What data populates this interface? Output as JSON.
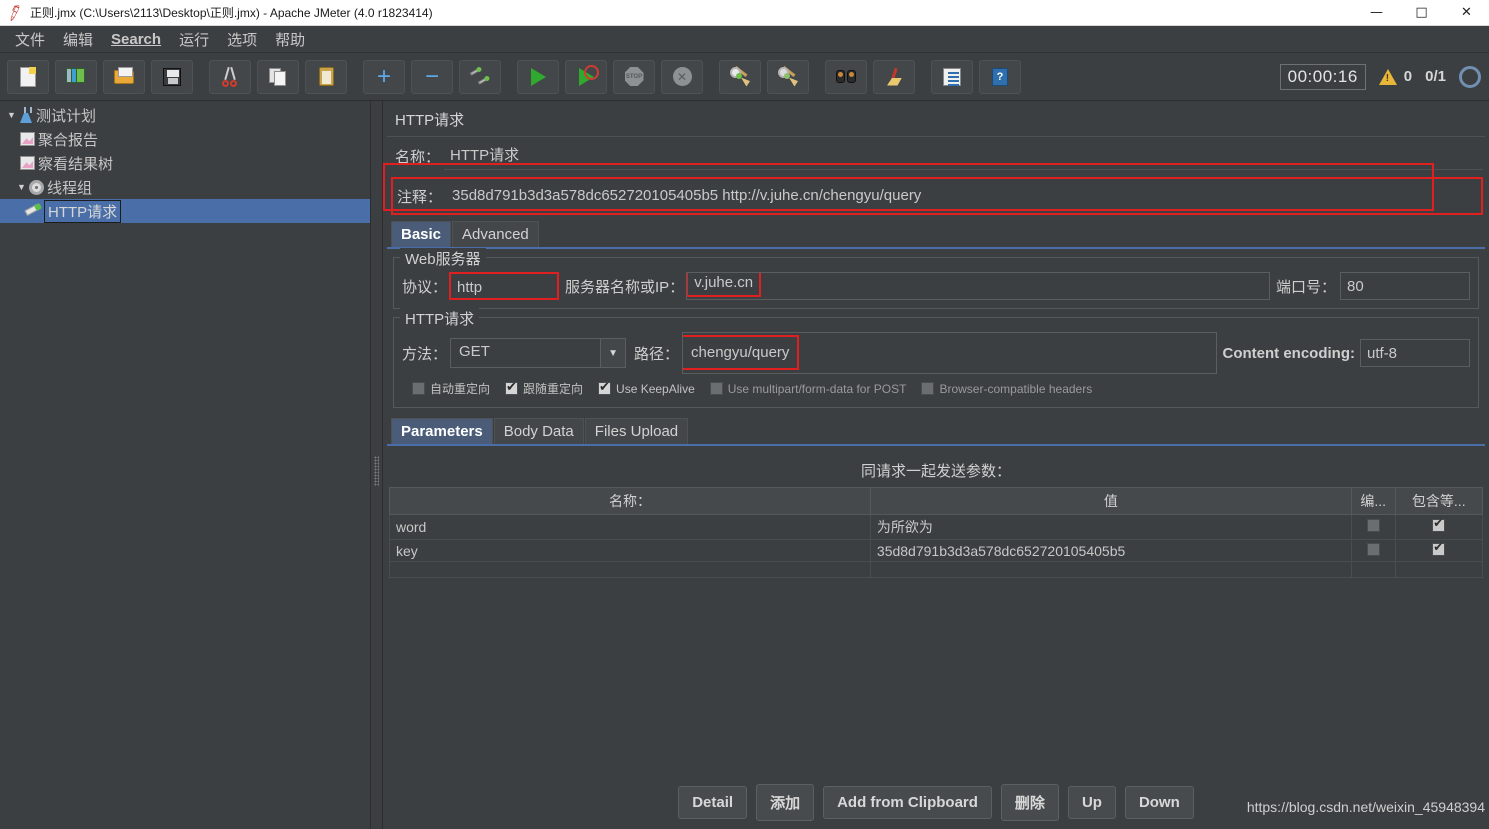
{
  "window": {
    "title": "正则.jmx (C:\\Users\\2113\\Desktop\\正则.jmx) - Apache JMeter (4.0 r1823414)",
    "app_icon": "jmeter-feather-icon",
    "minimize": "—",
    "maximize": "□",
    "close": "✕"
  },
  "menu": [
    {
      "label": "文件",
      "name": "menu-file"
    },
    {
      "label": "编辑",
      "name": "menu-edit"
    },
    {
      "label": "Search",
      "name": "menu-search"
    },
    {
      "label": "运行",
      "name": "menu-run"
    },
    {
      "label": "选项",
      "name": "menu-options"
    },
    {
      "label": "帮助",
      "name": "menu-help"
    }
  ],
  "toolbar": {
    "buttons": [
      {
        "name": "new-button",
        "icon": "new-document-icon"
      },
      {
        "name": "templates-button",
        "icon": "templates-icon"
      },
      {
        "name": "open-button",
        "icon": "open-folder-icon"
      },
      {
        "name": "save-button",
        "icon": "save-floppy-icon"
      },
      {
        "name": "cut-button",
        "icon": "scissors-icon"
      },
      {
        "name": "copy-button",
        "icon": "copy-icon"
      },
      {
        "name": "paste-button",
        "icon": "clipboard-icon"
      },
      {
        "name": "expand-all-button",
        "icon": "plus-icon"
      },
      {
        "name": "collapse-all-button",
        "icon": "minus-icon"
      },
      {
        "name": "toggle-button",
        "icon": "toggle-icon"
      },
      {
        "name": "start-button",
        "icon": "play-icon"
      },
      {
        "name": "start-no-pauses-button",
        "icon": "play-no-pause-icon"
      },
      {
        "name": "stop-button",
        "icon": "stop-icon"
      },
      {
        "name": "shutdown-button",
        "icon": "shutdown-icon"
      },
      {
        "name": "clear-button",
        "icon": "clear-broom-icon"
      },
      {
        "name": "clear-all-button",
        "icon": "clear-all-broom-icon"
      },
      {
        "name": "search-button",
        "icon": "binoculars-icon"
      },
      {
        "name": "reset-search-button",
        "icon": "reset-broom-icon"
      },
      {
        "name": "function-helper-button",
        "icon": "function-helper-icon"
      },
      {
        "name": "help-button",
        "icon": "help-book-icon"
      }
    ],
    "status": {
      "timer": "00:00:16",
      "warning_count": "0",
      "thread_count": "0/1",
      "warning_icon": "warning-triangle-icon",
      "thread_icon": "thread-gauge-icon"
    }
  },
  "tree": {
    "items": [
      {
        "label": "测试计划",
        "icon": "test-plan-icon",
        "indent": 0,
        "expanded": true,
        "selected": false,
        "name": "tree-item-test-plan"
      },
      {
        "label": "聚合报告",
        "icon": "aggregate-report-icon",
        "indent": 1,
        "expanded": null,
        "selected": false,
        "name": "tree-item-aggregate-report"
      },
      {
        "label": "察看结果树",
        "icon": "view-results-tree-icon",
        "indent": 1,
        "expanded": null,
        "selected": false,
        "name": "tree-item-view-results-tree"
      },
      {
        "label": "线程组",
        "icon": "thread-group-icon",
        "indent": 1,
        "expanded": true,
        "selected": false,
        "name": "tree-item-thread-group"
      },
      {
        "label": "HTTP请求",
        "icon": "http-request-icon",
        "indent": 2,
        "expanded": null,
        "selected": true,
        "name": "tree-item-http-request"
      }
    ]
  },
  "form": {
    "title": "HTTP请求",
    "name_label": "名称：",
    "name_value": "HTTP请求",
    "comment_label": "注释：",
    "comment_value": "35d8d791b3d3a578dc652720105405b5    http://v.juhe.cn/chengyu/query",
    "tabs": [
      {
        "label": "Basic",
        "active": true,
        "name": "tab-basic"
      },
      {
        "label": "Advanced",
        "active": false,
        "name": "tab-advanced"
      }
    ],
    "web_server": {
      "group_title": "Web服务器",
      "protocol_label": "协议：",
      "protocol_value": "http",
      "server_label": "服务器名称或IP：",
      "server_value": "v.juhe.cn",
      "port_label": "端口号：",
      "port_value": "80"
    },
    "http_request": {
      "group_title": "HTTP请求",
      "method_label": "方法：",
      "method_value": "GET",
      "path_label": "路径：",
      "path_value": "chengyu/query",
      "encoding_label": "Content encoding:",
      "encoding_value": "utf-8",
      "checkboxes": [
        {
          "label": "自动重定向",
          "checked": false,
          "name": "checkbox-auto-redirect"
        },
        {
          "label": "跟随重定向",
          "checked": true,
          "name": "checkbox-follow-redirects"
        },
        {
          "label": "Use KeepAlive",
          "checked": true,
          "name": "checkbox-use-keepalive"
        },
        {
          "label": "Use multipart/form-data for POST",
          "checked": false,
          "name": "checkbox-multipart"
        },
        {
          "label": "Browser-compatible headers",
          "checked": false,
          "name": "checkbox-browser-compatible-headers"
        }
      ]
    },
    "param_tabs": [
      {
        "label": "Parameters",
        "active": true,
        "name": "tab-parameters"
      },
      {
        "label": "Body Data",
        "active": false,
        "name": "tab-body-data"
      },
      {
        "label": "Files Upload",
        "active": false,
        "name": "tab-files-upload"
      }
    ],
    "params": {
      "caption": "同请求一起发送参数：",
      "columns": [
        "名称：",
        "值",
        "编...",
        "包含等..."
      ],
      "rows": [
        {
          "name": "word",
          "value": "为所欲为",
          "encode": false,
          "include_equals": true
        },
        {
          "name": "key",
          "value": "35d8d791b3d3a578dc652720105405b5",
          "encode": false,
          "include_equals": true
        }
      ]
    },
    "buttons": [
      {
        "label": "Detail",
        "name": "detail-button"
      },
      {
        "label": "添加",
        "name": "add-button"
      },
      {
        "label": "Add from Clipboard",
        "name": "add-from-clipboard-button"
      },
      {
        "label": "删除",
        "name": "delete-button"
      },
      {
        "label": "Up",
        "name": "up-button"
      },
      {
        "label": "Down",
        "name": "down-button"
      }
    ]
  },
  "watermark": "https://blog.csdn.net/weixin_45948394",
  "colors": {
    "background": "#3c3f41",
    "selection": "#4a6fa8",
    "annotation": "#e02020",
    "accent_tab": "#4a5c78"
  }
}
